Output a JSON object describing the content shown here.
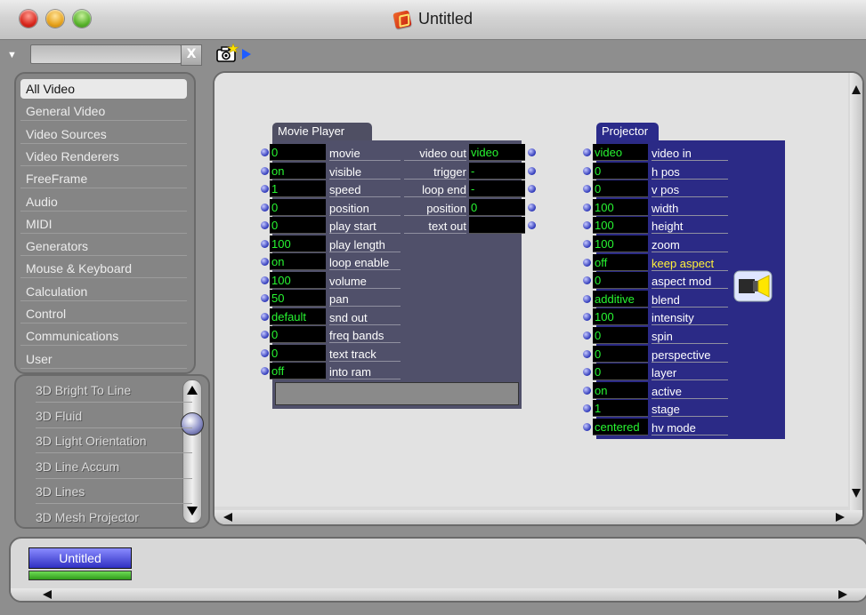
{
  "window": {
    "title": "Untitled"
  },
  "toolbar": {
    "camera_icon": "camera-icon",
    "play_icon": "play-triangle-icon"
  },
  "search": {
    "value": "",
    "clear_label": "X"
  },
  "categories": [
    {
      "label": "All Video",
      "selected": true
    },
    {
      "label": "General Video"
    },
    {
      "label": "Video Sources"
    },
    {
      "label": "Video Renderers"
    },
    {
      "label": "FreeFrame"
    },
    {
      "label": "Audio"
    },
    {
      "label": "MIDI"
    },
    {
      "label": "Generators"
    },
    {
      "label": "Mouse & Keyboard"
    },
    {
      "label": "Calculation"
    },
    {
      "label": "Control"
    },
    {
      "label": "Communications"
    },
    {
      "label": "User"
    }
  ],
  "modules": [
    {
      "label": "3D Bright To Line"
    },
    {
      "label": "3D Fluid"
    },
    {
      "label": "3D Light Orientation"
    },
    {
      "label": "3D Line Accum"
    },
    {
      "label": "3D Lines"
    },
    {
      "label": "3D Mesh Projector"
    }
  ],
  "movie_player": {
    "title": "Movie Player",
    "inputs": [
      {
        "value": "0",
        "label": "movie"
      },
      {
        "value": "on",
        "label": "visible"
      },
      {
        "value": "1",
        "label": "speed"
      },
      {
        "value": "0",
        "label": "position"
      },
      {
        "value": "0",
        "label": "play start"
      },
      {
        "value": "100",
        "label": "play length"
      },
      {
        "value": "on",
        "label": "loop enable"
      },
      {
        "value": "100",
        "label": "volume"
      },
      {
        "value": "50",
        "label": "pan"
      },
      {
        "value": "default",
        "label": "snd out"
      },
      {
        "value": "0",
        "label": "freq bands"
      },
      {
        "value": "0",
        "label": "text track"
      },
      {
        "value": "off",
        "label": "into ram"
      }
    ],
    "outputs": [
      {
        "label": "video out",
        "value": "video"
      },
      {
        "label": "trigger",
        "value": "-"
      },
      {
        "label": "loop end",
        "value": "-"
      },
      {
        "label": "position",
        "value": "0"
      },
      {
        "label": "text out",
        "value": ""
      }
    ]
  },
  "projector": {
    "title": "Projector",
    "inputs": [
      {
        "value": "video",
        "label": "video in"
      },
      {
        "value": "0",
        "label": "h pos"
      },
      {
        "value": "0",
        "label": "v pos"
      },
      {
        "value": "100",
        "label": "width"
      },
      {
        "value": "100",
        "label": "height"
      },
      {
        "value": "100",
        "label": "zoom"
      },
      {
        "value": "off",
        "label": "keep aspect",
        "highlight": true
      },
      {
        "value": "0",
        "label": "aspect mod"
      },
      {
        "value": "additive",
        "label": "blend"
      },
      {
        "value": "100",
        "label": "intensity"
      },
      {
        "value": "0",
        "label": "spin"
      },
      {
        "value": "0",
        "label": "perspective"
      },
      {
        "value": "0",
        "label": "layer"
      },
      {
        "value": "on",
        "label": "active"
      },
      {
        "value": "1",
        "label": "stage"
      },
      {
        "value": "centered",
        "label": "hv mode"
      }
    ]
  },
  "scenes": [
    {
      "label": "Untitled",
      "active": true
    }
  ],
  "colors": {
    "value_text": "#27f531",
    "highlight_label": "#fff13a",
    "movie_player_body": "#50506a",
    "projector_body": "#2b2a86",
    "scene_tab": "#2f2fc2"
  }
}
